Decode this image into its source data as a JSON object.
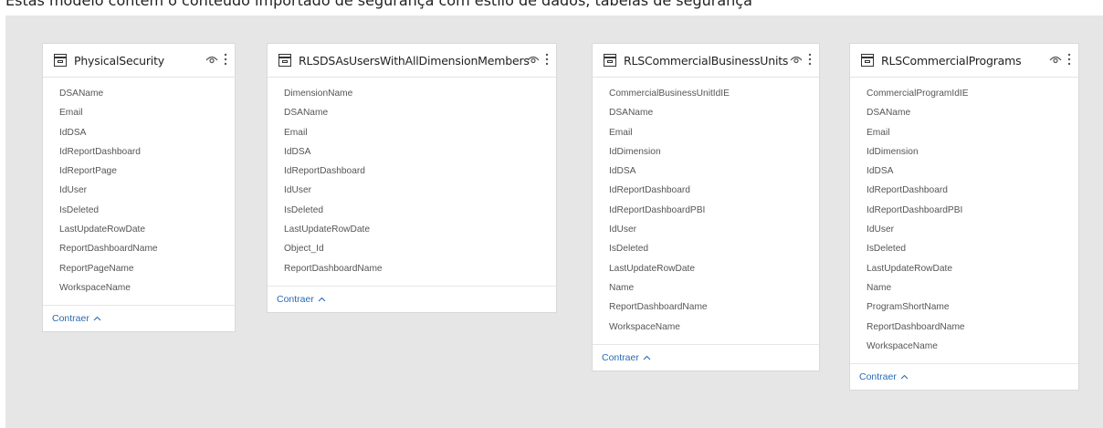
{
  "intro_text": "Estas modelo contém o conteúdo importado de segurança com estilo de dados, tabelas de segurança",
  "accent_color": "#2a6bb5",
  "tables": [
    {
      "name": "PhysicalSecurity",
      "fields": [
        "DSAName",
        "Email",
        "IdDSA",
        "IdReportDashboard",
        "IdReportPage",
        "IdUser",
        "IsDeleted",
        "LastUpdateRowDate",
        "ReportDashboardName",
        "ReportPageName",
        "WorkspaceName"
      ],
      "collapse_label": "Contraer"
    },
    {
      "name": "RLSDSAsUsersWithAllDimensionMembers",
      "fields": [
        "DimensionName",
        "DSAName",
        "Email",
        "IdDSA",
        "IdReportDashboard",
        "IdUser",
        "IsDeleted",
        "LastUpdateRowDate",
        "Object_Id",
        "ReportDashboardName"
      ],
      "collapse_label": "Contraer"
    },
    {
      "name": "RLSCommercialBusinessUnits",
      "fields": [
        "CommercialBusinessUnitIdIE",
        "DSAName",
        "Email",
        "IdDimension",
        "IdDSA",
        "IdReportDashboard",
        "IdReportDashboardPBI",
        "IdUser",
        "IsDeleted",
        "LastUpdateRowDate",
        "Name",
        "ReportDashboardName",
        "WorkspaceName"
      ],
      "collapse_label": "Contraer"
    },
    {
      "name": "RLSCommercialPrograms",
      "fields": [
        "CommercialProgramIdIE",
        "DSAName",
        "Email",
        "IdDimension",
        "IdDSA",
        "IdReportDashboard",
        "IdReportDashboardPBI",
        "IdUser",
        "IsDeleted",
        "LastUpdateRowDate",
        "Name",
        "ProgramShortName",
        "ReportDashboardName",
        "WorkspaceName"
      ],
      "collapse_label": "Contraer"
    }
  ]
}
